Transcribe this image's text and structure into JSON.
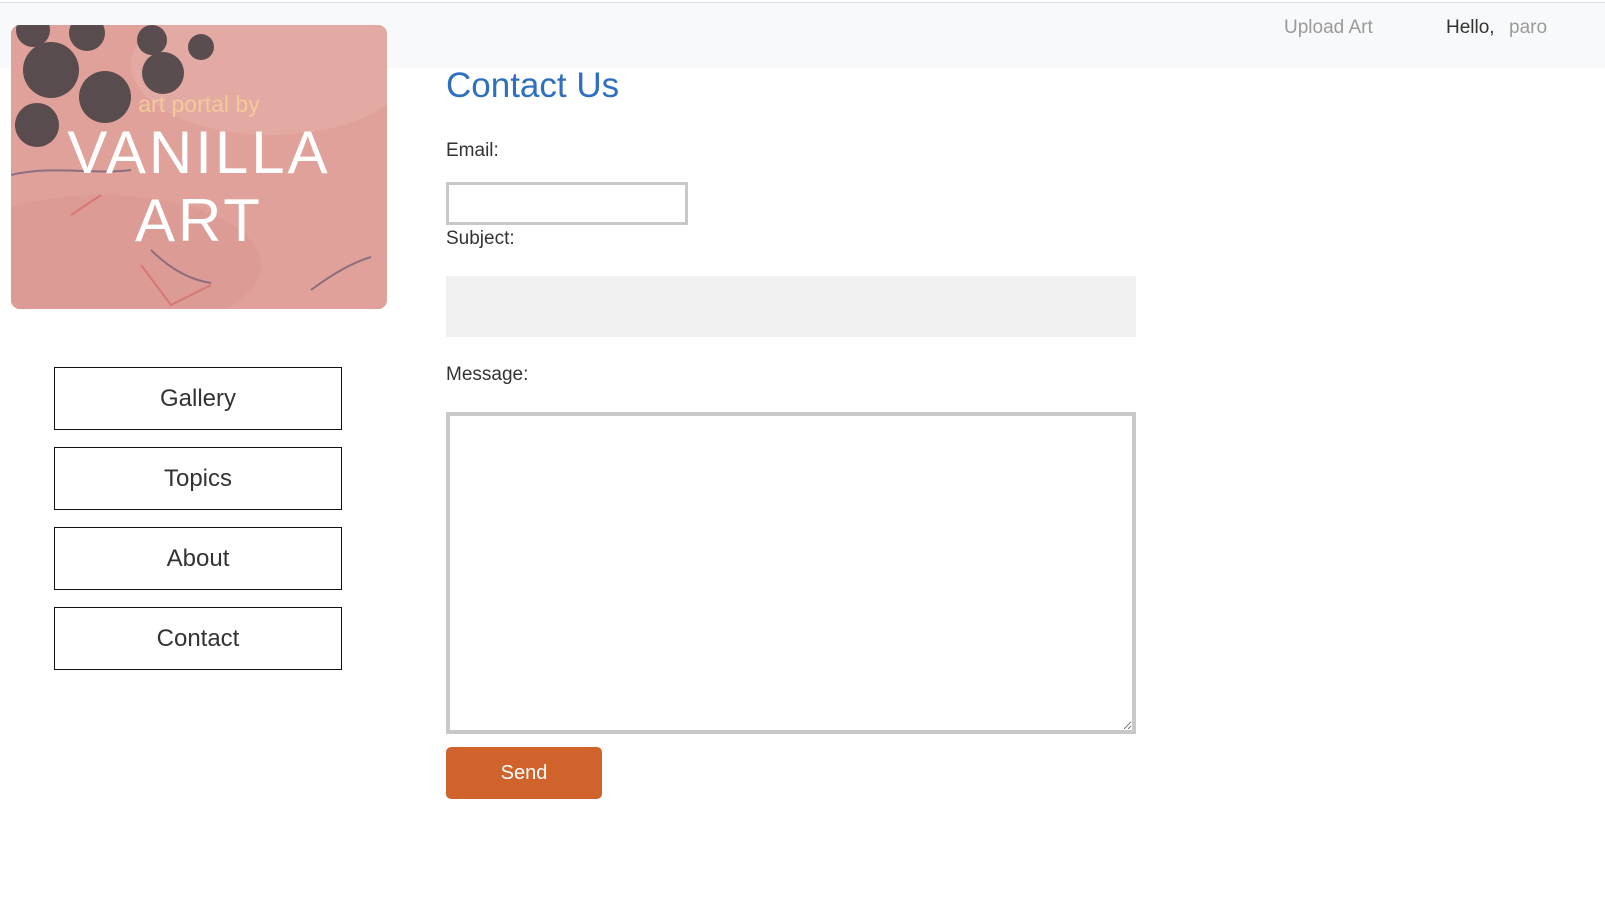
{
  "header": {
    "upload_label": "Upload Art",
    "greeting": "Hello,",
    "username": "paro"
  },
  "logo": {
    "subtitle": "art portal by",
    "title_line1": "VANILLA",
    "title_line2": "ART"
  },
  "sidebar": {
    "items": [
      {
        "label": "Gallery"
      },
      {
        "label": "Topics"
      },
      {
        "label": "About"
      },
      {
        "label": "Contact"
      }
    ]
  },
  "form": {
    "title": "Contact Us",
    "email_label": "Email:",
    "email_value": "",
    "subject_label": "Subject:",
    "subject_value": "",
    "message_label": "Message:",
    "message_value": "",
    "send_label": "Send"
  },
  "colors": {
    "accent": "#d0632b",
    "title": "#2f6fc1",
    "topbar": "#f8f9fa"
  }
}
